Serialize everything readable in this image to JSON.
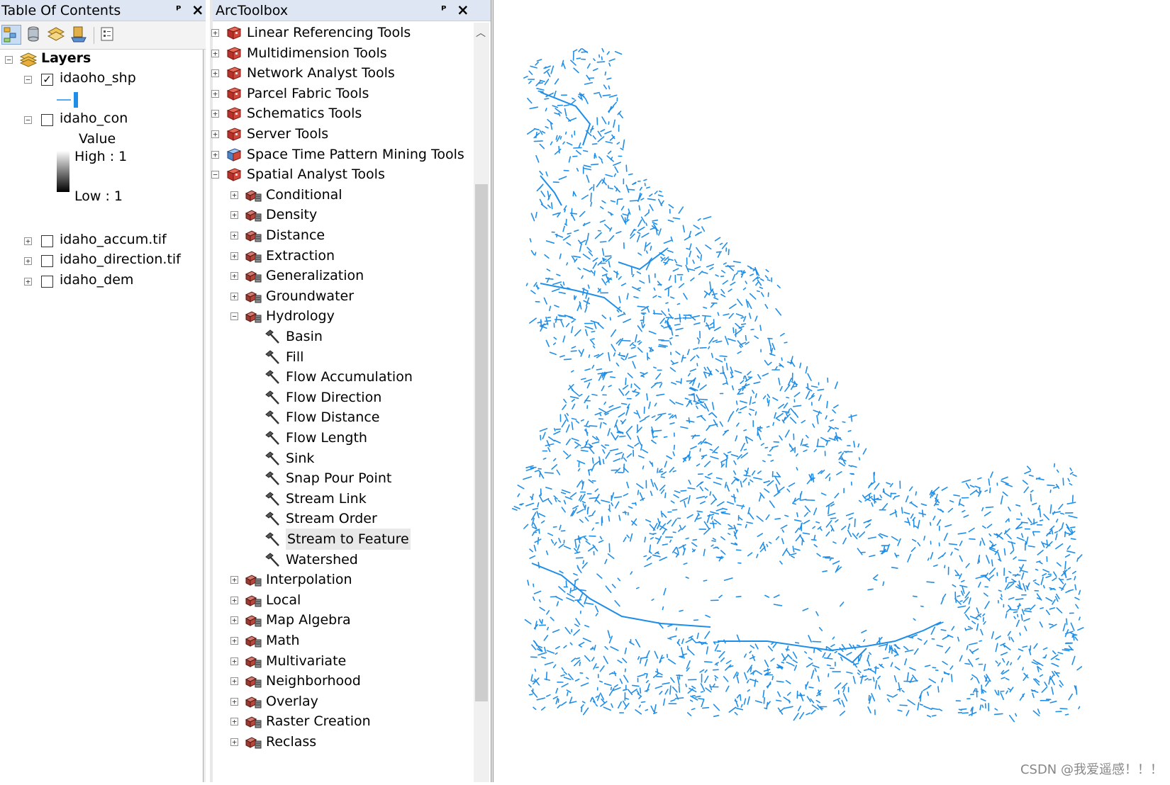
{
  "toc": {
    "title": "Table Of Contents",
    "pin_glyph": "ᵖ",
    "close_glyph": "✕",
    "toolbar": [
      "list-by-drawing-order-icon",
      "list-by-source-icon",
      "list-by-visibility-icon",
      "list-by-selection-icon",
      "options-icon"
    ],
    "root_label": "Layers",
    "layers": [
      {
        "name": "idaoho_shp",
        "checked": true,
        "expanded": true
      },
      {
        "name": "idaho_con",
        "checked": false,
        "expanded": true,
        "legend": {
          "title": "Value",
          "high": "High : 1",
          "low": "Low : 1"
        }
      },
      {
        "name": "idaho_accum.tif",
        "checked": false,
        "expanded": false
      },
      {
        "name": "idaho_direction.tif",
        "checked": false,
        "expanded": false
      },
      {
        "name": "idaho_dem",
        "checked": false,
        "expanded": false
      }
    ]
  },
  "arctoolbox": {
    "title": "ArcToolbox",
    "toolboxes": [
      {
        "label": "Linear Referencing Tools",
        "expanded": false
      },
      {
        "label": "Multidimension Tools",
        "expanded": false
      },
      {
        "label": "Network Analyst Tools",
        "expanded": false
      },
      {
        "label": "Parcel Fabric Tools",
        "expanded": false
      },
      {
        "label": "Schematics Tools",
        "expanded": false
      },
      {
        "label": "Server Tools",
        "expanded": false
      },
      {
        "label": "Space Time Pattern Mining Tools",
        "expanded": false
      },
      {
        "label": "Spatial Analyst Tools",
        "expanded": true
      }
    ],
    "toolsets": [
      {
        "label": "Conditional",
        "expanded": false
      },
      {
        "label": "Density",
        "expanded": false
      },
      {
        "label": "Distance",
        "expanded": false
      },
      {
        "label": "Extraction",
        "expanded": false
      },
      {
        "label": "Generalization",
        "expanded": false
      },
      {
        "label": "Groundwater",
        "expanded": false
      },
      {
        "label": "Hydrology",
        "expanded": true
      }
    ],
    "hydrology_tools": [
      "Basin",
      "Fill",
      "Flow Accumulation",
      "Flow Direction",
      "Flow Distance",
      "Flow Length",
      "Sink",
      "Snap Pour Point",
      "Stream Link",
      "Stream Order",
      "Stream to Feature",
      "Watershed"
    ],
    "selected_tool": "Stream to Feature",
    "toolsets_after": [
      "Interpolation",
      "Local",
      "Map Algebra",
      "Math",
      "Multivariate",
      "Neighborhood",
      "Overlay",
      "Raster Creation",
      "Reclass"
    ]
  },
  "map": {
    "stream_color": "#1f8ee8",
    "watermark": "CSDN @我爱遥感！！！"
  }
}
